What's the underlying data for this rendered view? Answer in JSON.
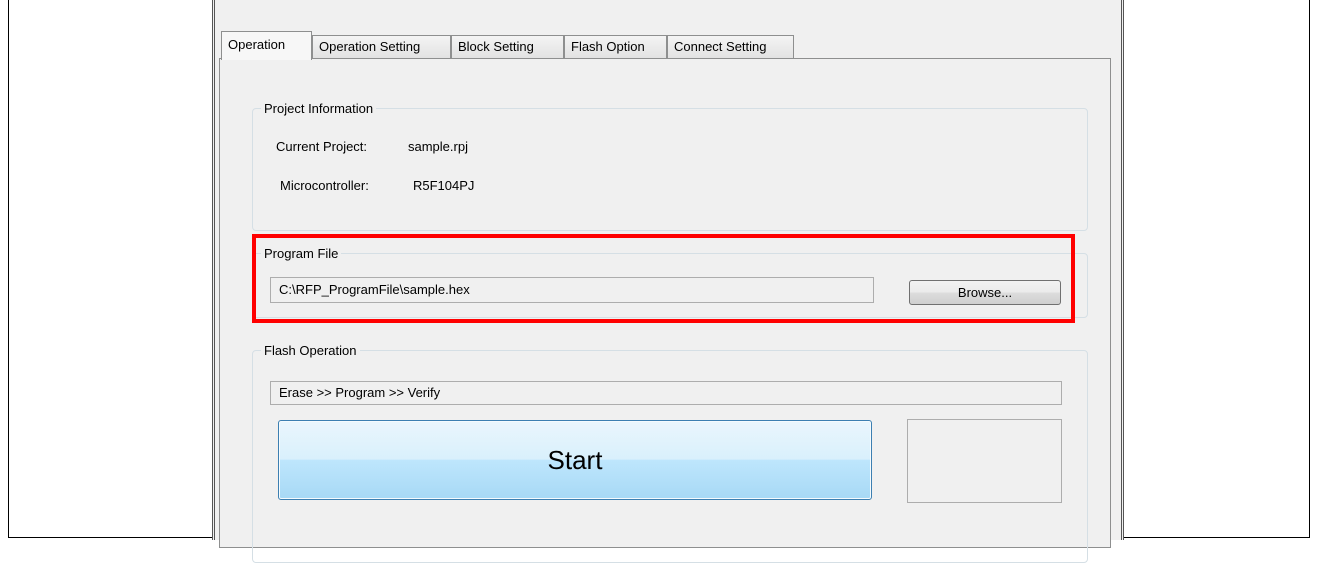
{
  "tabs": [
    {
      "label": "Operation",
      "active": true
    },
    {
      "label": "Operation Setting",
      "active": false
    },
    {
      "label": "Block Setting",
      "active": false
    },
    {
      "label": "Flash Option",
      "active": false
    },
    {
      "label": "Connect Setting",
      "active": false
    }
  ],
  "project_info": {
    "legend": "Project Information",
    "current_project_label": "Current Project:",
    "current_project_value": "sample.rpj",
    "microcontroller_label": "Microcontroller:",
    "microcontroller_value": "R5F104PJ"
  },
  "program_file": {
    "legend": "Program File",
    "path": "C:\\RFP_ProgramFile\\sample.hex",
    "browse_label": "Browse..."
  },
  "flash_operation": {
    "legend": "Flash Operation",
    "sequence_prefix": "Erase >> Program >> ",
    "sequence_last": "Verify",
    "start_label": "Start"
  },
  "colors": {
    "highlight": "#ff0000",
    "start_button": "#bee6fd",
    "window_bg": "#f0f0f0"
  }
}
